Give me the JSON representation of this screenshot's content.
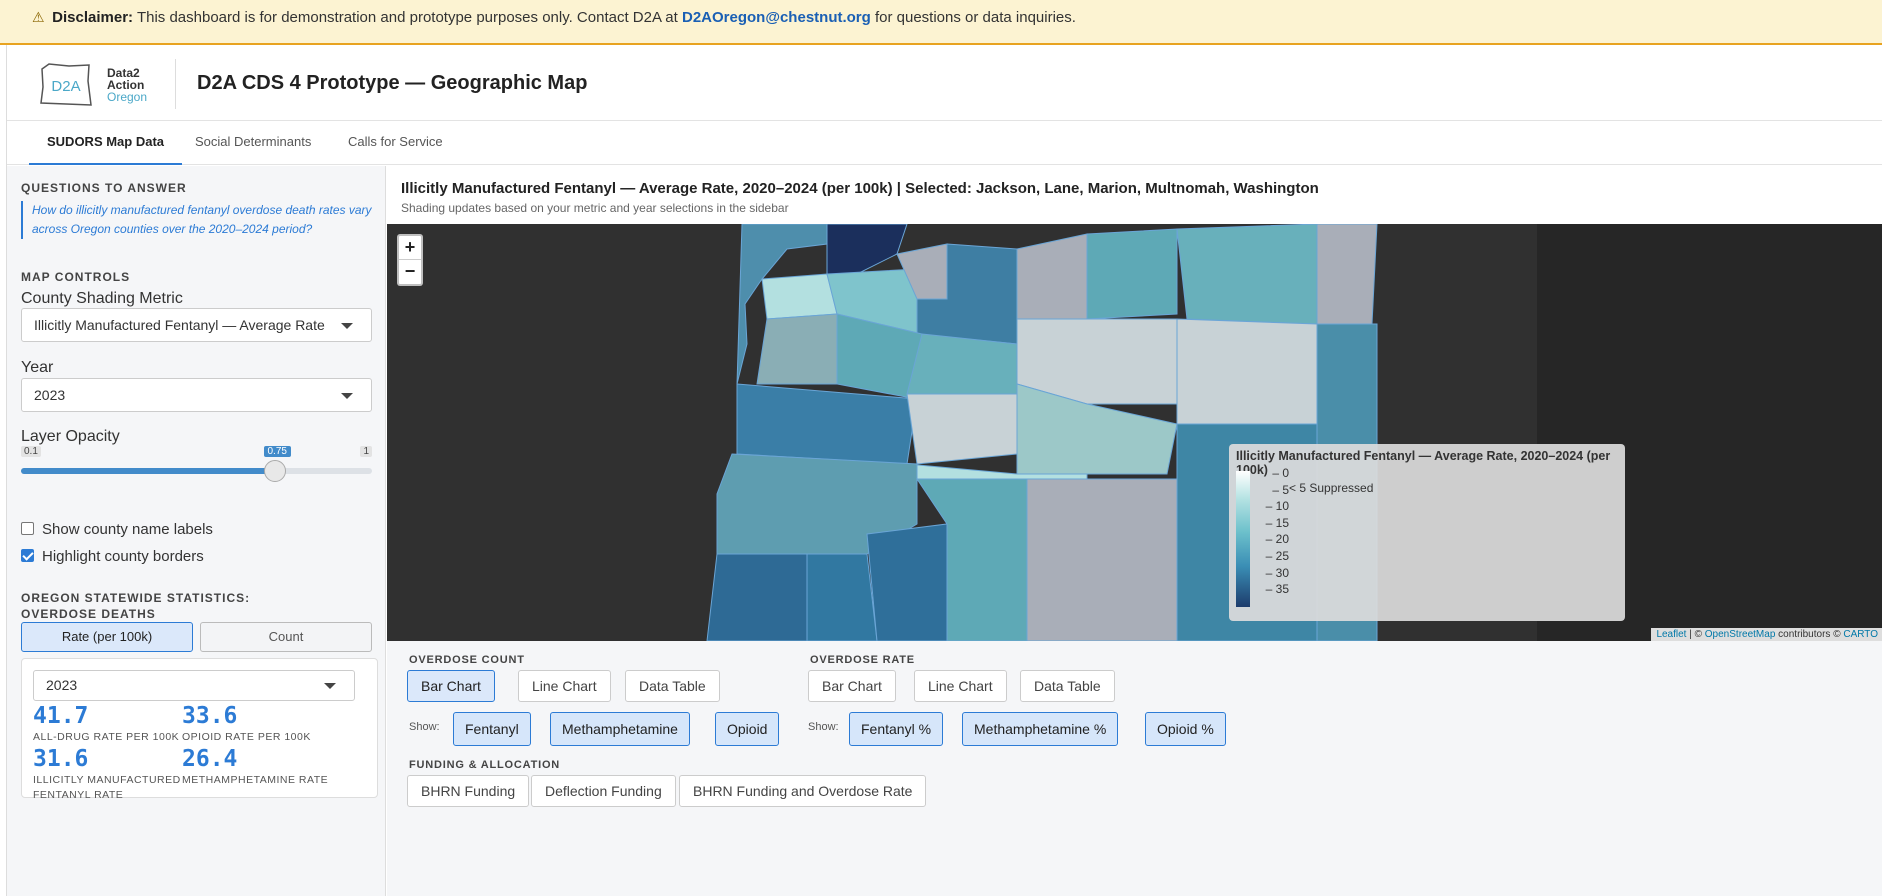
{
  "banner": {
    "label": "Disclaimer:",
    "text": "This dashboard is for demonstration and prototype purposes only. Contact D2A at",
    "email": "D2AOregon@chestnut.org",
    "suffix": "for questions or data inquiries."
  },
  "header": {
    "logo_mark": "D2A",
    "logo_line1": "Data2",
    "logo_line2": "Action",
    "logo_line3": "Oregon",
    "title": "D2A CDS 4 Prototype — Geographic Map"
  },
  "tabs": [
    "SUDORS Map Data",
    "Social Determinants",
    "Calls for Service"
  ],
  "sidebar": {
    "questions_title": "QUESTIONS TO ANSWER",
    "question": "How do illicitly manufactured fentanyl overdose death rates vary across Oregon counties over the 2020–2024 period?",
    "map_controls_title": "MAP CONTROLS",
    "metric_label": "County Shading Metric",
    "metric_value": "Illicitly Manufactured Fentanyl — Average Rate",
    "year_label": "Year",
    "year_value": "2023",
    "opacity_label": "Layer Opacity",
    "opacity_min": "0.1",
    "opacity_max": "1",
    "opacity_value": "0.75",
    "opacity_fraction": 0.75,
    "show_labels": "Show county name labels",
    "highlight_borders": "Highlight county borders",
    "stats_title": "OREGON STATEWIDE STATISTICS: OVERDOSE DEATHS",
    "toggle_rate": "Rate (per 100k)",
    "toggle_count": "Count",
    "stats_year": "2023",
    "stats": [
      {
        "value": "41.7",
        "label": "ALL-DRUG RATE PER 100K"
      },
      {
        "value": "33.6",
        "label": "OPIOID RATE PER 100K"
      },
      {
        "value": "31.6",
        "label": "ILLICITLY MANUFACTURED FENTANYL RATE"
      },
      {
        "value": "26.4",
        "label": "METHAMPHETAMINE RATE"
      }
    ]
  },
  "main": {
    "title": "Illicitly Manufactured Fentanyl — Average Rate, 2020–2024 (per 100k) | Selected: Jackson, Lane, Marion, Multnomah, Washington",
    "subtitle": "Shading updates based on your metric and year selections in the sidebar"
  },
  "map": {
    "zoom_in": "+",
    "zoom_out": "−",
    "legend_title": "Illicitly Manufactured Fentanyl — Average Rate, 2020–2024 (per 100k)",
    "legend_ticks": [
      "0",
      "5",
      "10",
      "15",
      "20",
      "25",
      "30",
      "35"
    ],
    "legend_suppressed": "< 5 Suppressed",
    "attrib_leaflet": "Leaflet",
    "attrib_mid": "| ©",
    "attrib_osm": "OpenStreetMap",
    "attrib_contrib": "contributors ©",
    "attrib_carto": "CARTO",
    "colors": {
      "suppressed": "#a9aeb8",
      "low": "#b3e0e0",
      "mid": "#5ea9b6",
      "high": "#2f6f9a",
      "max": "#1b2f5c"
    }
  },
  "controls": {
    "count_title": "OVERDOSE COUNT",
    "count_buttons": [
      "Bar Chart",
      "Line Chart",
      "Data Table"
    ],
    "count_show": "Show:",
    "count_pills": [
      "Fentanyl",
      "Methamphetamine",
      "Opioid"
    ],
    "rate_title": "OVERDOSE RATE",
    "rate_buttons": [
      "Bar Chart",
      "Line Chart",
      "Data Table"
    ],
    "rate_show": "Show:",
    "rate_pills": [
      "Fentanyl %",
      "Methamphetamine %",
      "Opioid %"
    ],
    "funding_title": "FUNDING & ALLOCATION",
    "funding_buttons": [
      "BHRN Funding",
      "Deflection Funding",
      "BHRN Funding and Overdose Rate"
    ]
  }
}
